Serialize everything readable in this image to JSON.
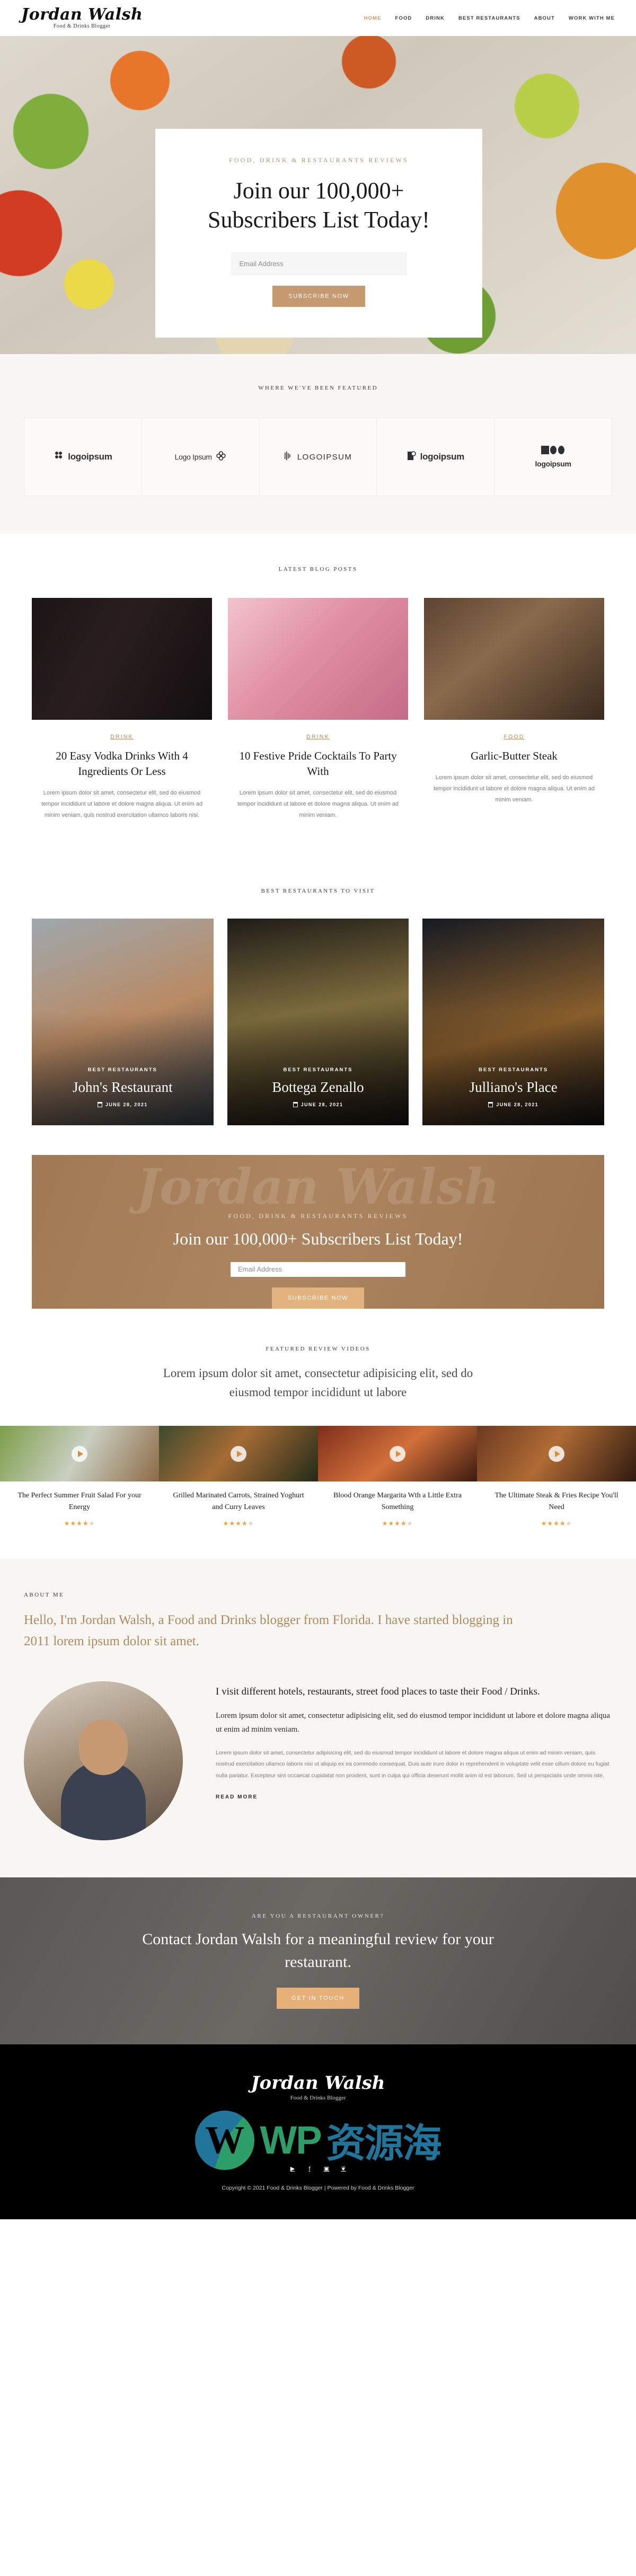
{
  "brand": {
    "name": "Jordan Walsh",
    "tagline": "Food & Drinks Blogger"
  },
  "nav": {
    "items": [
      {
        "label": "HOME",
        "active": true
      },
      {
        "label": "FOOD",
        "active": false
      },
      {
        "label": "DRINK",
        "active": false
      },
      {
        "label": "BEST RESTAURANTS",
        "active": false
      },
      {
        "label": "ABOUT",
        "active": false
      },
      {
        "label": "WORK WITH ME",
        "active": false
      }
    ]
  },
  "hero": {
    "eyebrow": "FOOD, DRINK & RESTAURANTS REVIEWS",
    "headline": "Join our 100,000+ Subscribers List Today!",
    "email_placeholder": "Email Address",
    "email_value": "",
    "button": "SUBSCRIBE NOW"
  },
  "featured": {
    "label": "WHERE WE'VE BEEN FEATURED",
    "logos": [
      {
        "text": "logoipsum",
        "mark": "hex-cluster-icon"
      },
      {
        "text": "Logo Ipsum",
        "mark": "flower-icon"
      },
      {
        "text": "LOGOIPSUM",
        "mark": "bars-icon"
      },
      {
        "text": "logoipsum",
        "mark": "tag-icon"
      },
      {
        "text": "logoipsum",
        "mark": "square-circles-icon"
      }
    ]
  },
  "posts": {
    "label": "LATEST BLOG POSTS",
    "items": [
      {
        "category": "DRINK",
        "title": "20 Easy Vodka Drinks With 4 Ingredients Or Less",
        "excerpt": "Lorem ipsum dolor sit amet, consectetur elit, sed do eiusmod tempor incididunt ut labore et dolore magna aliqua. Ut enim ad minim veniam, quis nostrud exercitation ullamco laboris nisi."
      },
      {
        "category": "DRINK",
        "title": "10 Festive Pride Cocktails To Party With",
        "excerpt": "Lorem ipsum dolor sit amet, consectetur elit, sed do eiusmod tempor incididunt ut labore et dolore magna aliqua. Ut enim ad minim veniam."
      },
      {
        "category": "FOOD",
        "title": "Garlic-Butter Steak",
        "excerpt": "Lorem ipsum dolor sit amet, consectetur elit, sed do eiusmod tempor incididunt ut labore et dolore magna aliqua. Ut enim ad minim veniam."
      }
    ]
  },
  "restaurants": {
    "label": "BEST RESTAURANTS TO VISIT",
    "items": [
      {
        "category": "BEST RESTAURANTS",
        "name": "John's Restaurant",
        "date": "JUNE 28, 2021"
      },
      {
        "category": "BEST RESTAURANTS",
        "name": "Bottega Zenallo",
        "date": "JUNE 28, 2021"
      },
      {
        "category": "BEST RESTAURANTS",
        "name": "Julliano's Place",
        "date": "JUNE 28, 2021"
      }
    ]
  },
  "cta_band": {
    "eyebrow": "FOOD, DRINK & RESTAURANTS REVIEWS",
    "headline": "Join our 100,000+ Subscribers List Today!",
    "email_placeholder": "Email Address",
    "email_value": "",
    "button": "SUBSCRIBE NOW",
    "script_text": "Jordan Walsh"
  },
  "videos": {
    "label": "FEATURED REVIEW VIDEOS",
    "subtitle": "Lorem ipsum dolor sit amet, consectetur adipisicing elit, sed do eiusmod tempor incididunt ut labore",
    "items": [
      {
        "title": "The Perfect Summer Fruit Salad For your Energy",
        "rating": "4.5"
      },
      {
        "title": "Grilled Marinated Carrots, Strained Yoghurt and Curry Leaves",
        "rating": "4.5"
      },
      {
        "title": "Blood Orange Margarita Wth a Little Extra Something",
        "rating": "4.5"
      },
      {
        "title": "The Ultimate Steak & Fries Recipe You'll Need",
        "rating": "4.5"
      }
    ]
  },
  "about": {
    "label": "ABOUT ME",
    "lead": "Hello, I'm Jordan Walsh, a Food and Drinks blogger from Florida. I have started blogging in 2011 lorem ipsum dolor sit amet.",
    "heading": "I visit different hotels, restaurants, street food places to taste their Food / Drinks.",
    "paragraph_1": "Lorem ipsum dolor sit amet, consectetur adipisicing elit, sed do eiusmod tempor incididunt ut labore et dolore magna aliqua ut enim ad minim veniam.",
    "paragraph_2": "Lorem ipsum dolor sit amet, consectetur adipisicing elit, sed do eiusmod tempor incididunt ut labore et dolore magna aliqua ut enim ad minim veniam, quis nostrud exercitation ullamco laboris nisi ut aliquip ex ea commodo consequat. Duis aute irure dolor in reprehenderit in voluptate velit esse cillum dolore eu fugiat nulla pariatur. Excepteur sint occaecat cupidatat non proident, sunt in culpa qui officia deserunt mollit anim id est laborum. Sed ut perspiciatis unde omnis iste.",
    "read_more": "READ MORE"
  },
  "contact": {
    "eyebrow": "ARE YOU A RESTAURANT OWNER?",
    "headline": "Contact Jordan Walsh for a meaningful review for your restaurant.",
    "button": "GET IN TOUCH"
  },
  "footer": {
    "brand": "Jordan Walsh",
    "tagline": "Food & Drinks Blogger",
    "socials": [
      {
        "name": "youtube-icon",
        "glyph": "▶"
      },
      {
        "name": "facebook-icon",
        "glyph": "f"
      },
      {
        "name": "instagram-icon",
        "glyph": "▣"
      },
      {
        "name": "twitter-icon",
        "glyph": "❦"
      }
    ],
    "copyright": "Copyright © 2021 Food & Drinks Blogger | Powered by Food & Drinks Blogger"
  },
  "watermark": {
    "wp": "WP",
    "cn": "资源海",
    "mark": "W"
  },
  "colors": {
    "accent": "#c59a71",
    "accent_light": "#e2b27f",
    "dark": "#000000",
    "cream": "#f8f6f2"
  }
}
